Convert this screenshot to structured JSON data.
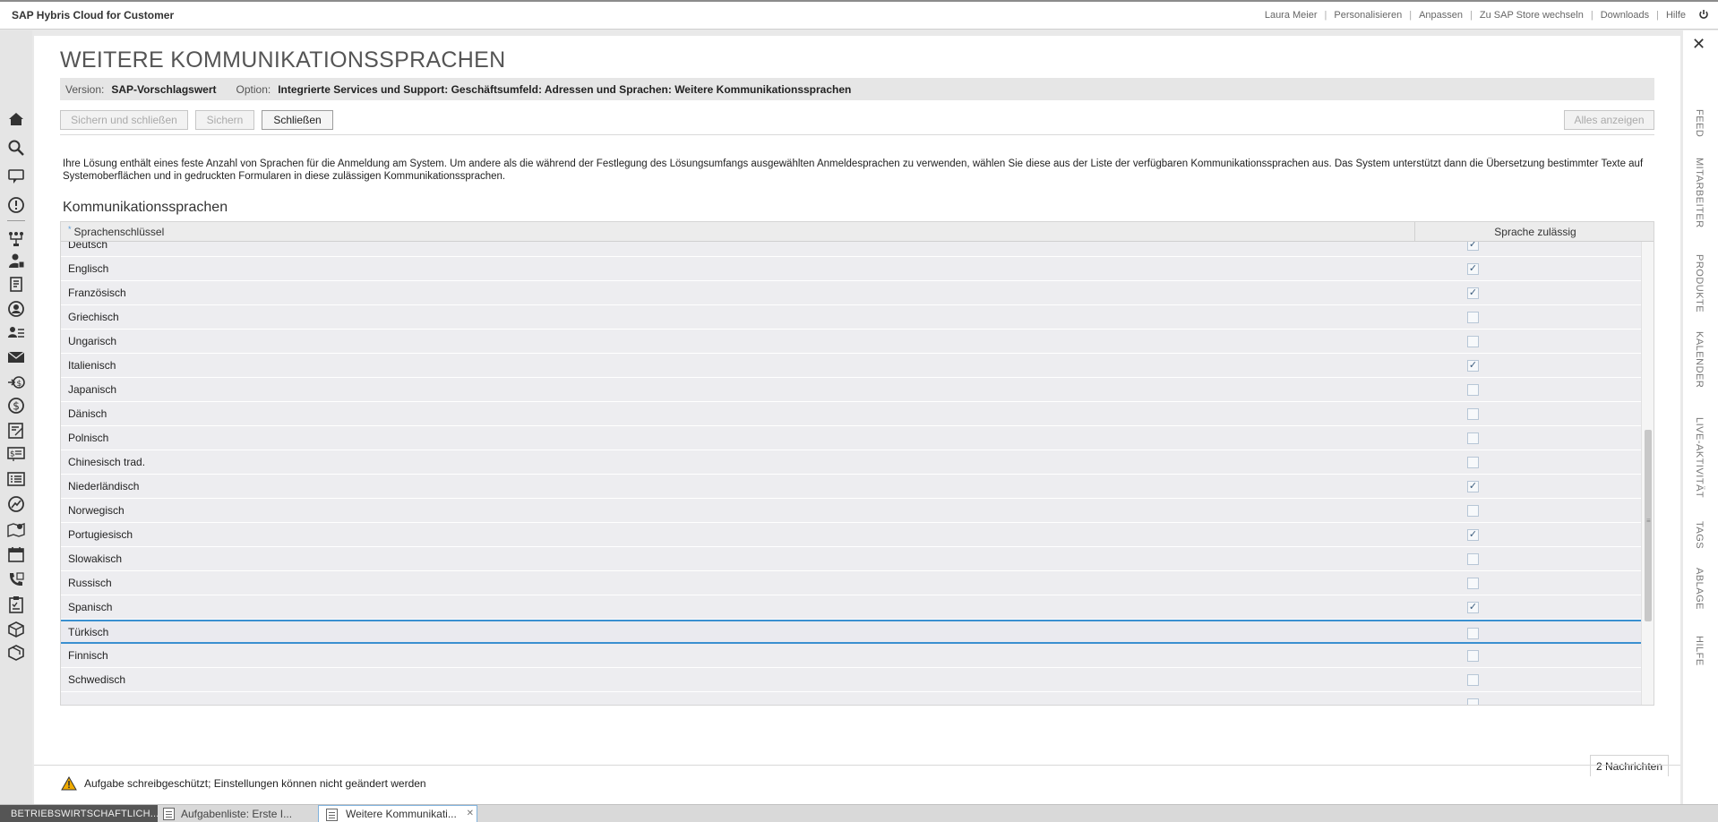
{
  "shell": {
    "brand": "SAP Hybris Cloud for Customer",
    "links": [
      "Laura Meier",
      "Personalisieren",
      "Anpassen",
      "Zu SAP Store wechseln",
      "Downloads",
      "Hilfe"
    ],
    "power_icon": "power-icon"
  },
  "left_nav_icons": [
    "home-icon",
    "search-icon",
    "feed-icon",
    "alert-icon",
    "workflow-icon",
    "customer-icon",
    "documents-icon",
    "person-icon",
    "contacts-icon",
    "email-icon",
    "sales-icon",
    "currency-icon",
    "report-icon",
    "pricing-icon",
    "list-icon",
    "analytics-icon",
    "map-icon",
    "calendar-icon",
    "phone-icon",
    "checklist-icon",
    "product-icon",
    "products-icon"
  ],
  "right_tabs": [
    "FEED",
    "MITARBEITER",
    "PRODUKTE",
    "KALENDER",
    "LIVE-AKTIVITÄT",
    "TAGS",
    "ABLAGE",
    "HILFE"
  ],
  "dialog": {
    "title": "WEITERE KOMMUNIKATIONSSPRACHEN",
    "version_label": "Version:",
    "version_value": "SAP-Vorschlagswert",
    "option_label": "Option:",
    "option_value": "Integrierte Services und Support: Geschäftsumfeld: Adressen und Sprachen: Weitere Kommunikationssprachen",
    "buttons": {
      "save_close": "Sichern und schließen",
      "save": "Sichern",
      "close": "Schließen",
      "show_all": "Alles anzeigen"
    },
    "description": "Ihre Lösung enthält eines feste Anzahl von Sprachen für die Anmeldung am System. Um andere als die während der Festlegung des Lösungsumfangs ausgewählten Anmeldesprachen zu verwenden, wählen Sie diese aus der Liste der verfügbaren Kommunikationssprachen aus. Das System unterstützt dann die Übersetzung bestimmter Texte auf Systemoberflächen und in gedruckten Formularen in diese zulässigen Kommunikationssprachen.",
    "section_title": "Kommunikationssprachen",
    "table": {
      "col_key": "Sprachenschlüssel",
      "col_allowed": "Sprache zulässig",
      "rows": [
        {
          "name": "Deutsch",
          "allowed": true
        },
        {
          "name": "Englisch",
          "allowed": true
        },
        {
          "name": "Französisch",
          "allowed": true
        },
        {
          "name": "Griechisch",
          "allowed": false
        },
        {
          "name": "Ungarisch",
          "allowed": false
        },
        {
          "name": "Italienisch",
          "allowed": true
        },
        {
          "name": "Japanisch",
          "allowed": false
        },
        {
          "name": "Dänisch",
          "allowed": false
        },
        {
          "name": "Polnisch",
          "allowed": false
        },
        {
          "name": "Chinesisch trad.",
          "allowed": false
        },
        {
          "name": "Niederländisch",
          "allowed": true
        },
        {
          "name": "Norwegisch",
          "allowed": false
        },
        {
          "name": "Portugiesisch",
          "allowed": true
        },
        {
          "name": "Slowakisch",
          "allowed": false
        },
        {
          "name": "Russisch",
          "allowed": false
        },
        {
          "name": "Spanisch",
          "allowed": true
        },
        {
          "name": "Türkisch",
          "allowed": false,
          "selected": true
        },
        {
          "name": "Finnisch",
          "allowed": false
        },
        {
          "name": "Schwedisch",
          "allowed": false
        },
        {
          "name": "",
          "allowed": false
        }
      ]
    },
    "message_count": "2 Nachrichten",
    "warning": "Aufgabe schreibgeschützt; Einstellungen können nicht geändert werden"
  },
  "taskbar": {
    "tasks": [
      "BETRIEBSWIRTSCHAFTLICH...",
      "Aufgabenliste: Erste I...",
      "Weitere Kommunikati..."
    ]
  },
  "colors": {
    "accent": "#3a8fd0",
    "warning": "#f0ab00"
  }
}
